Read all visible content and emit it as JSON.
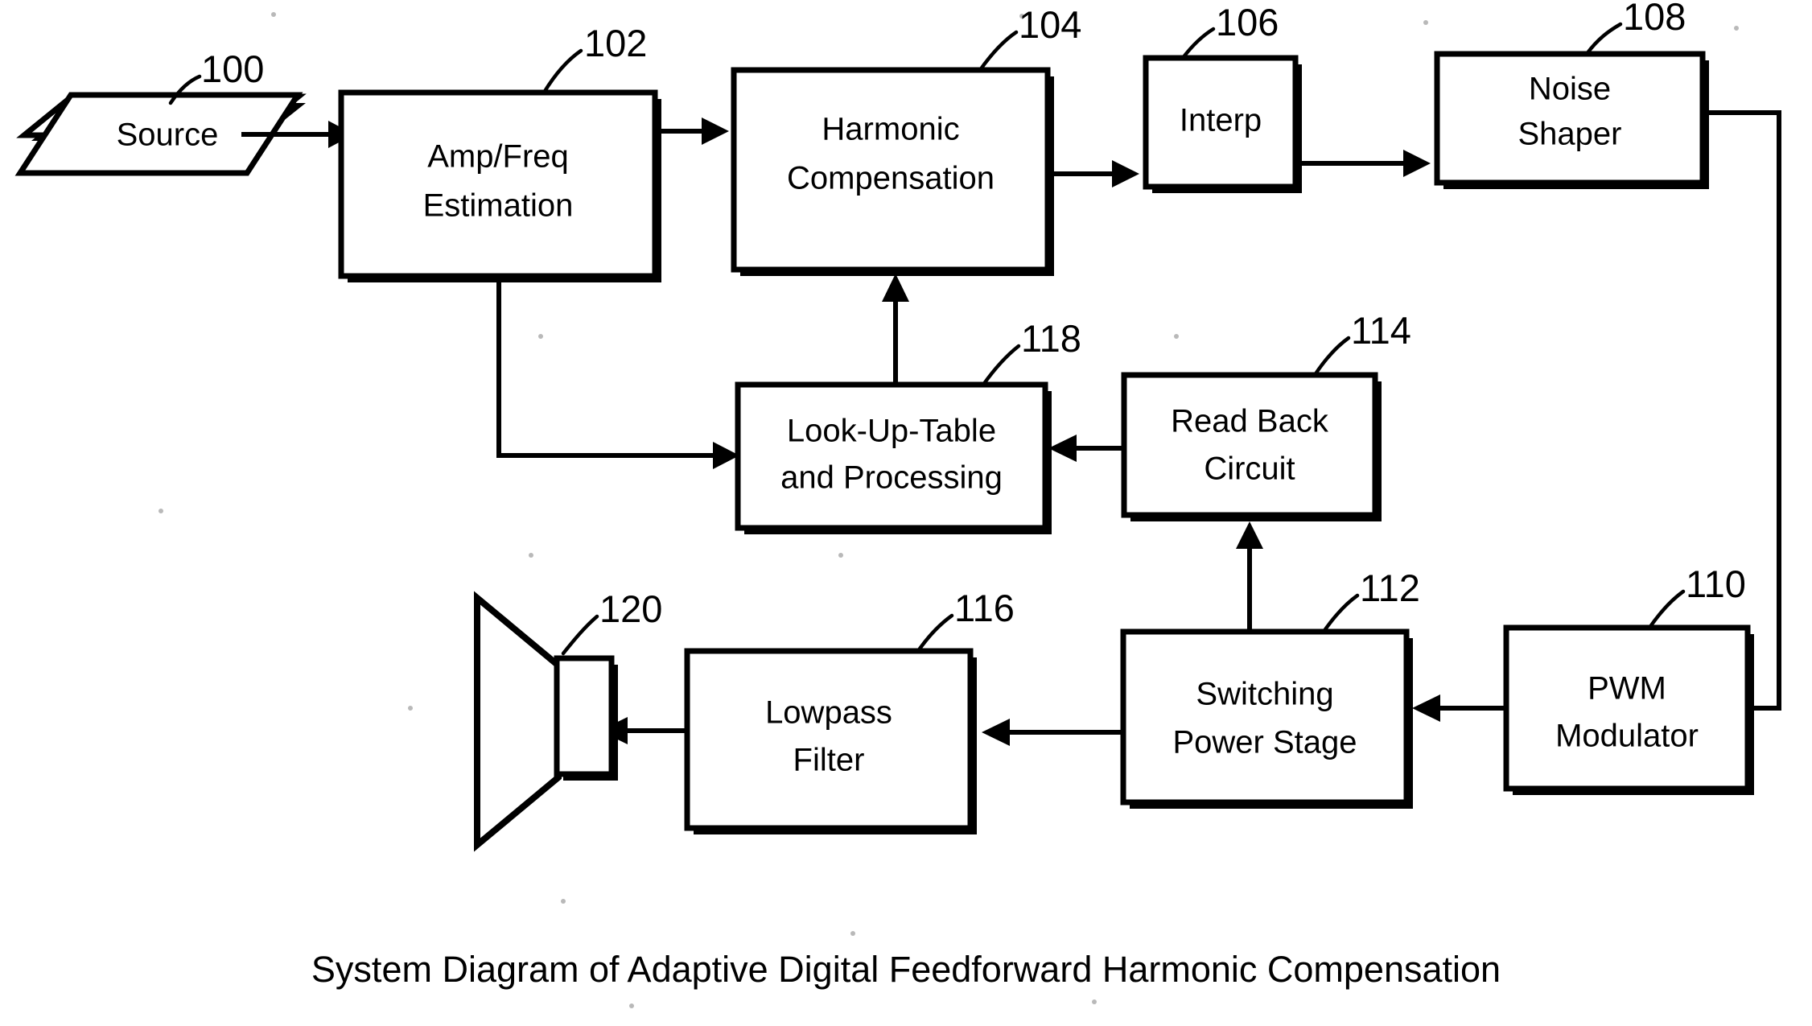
{
  "figure": {
    "caption": "System Diagram of Adaptive Digital Feedforward Harmonic Compensation",
    "line_color": "#000000",
    "background_color": "#ffffff"
  },
  "blocks": {
    "source": {
      "ref": "100",
      "label": "Source",
      "shape": "parallelogram"
    },
    "amp_freq": {
      "ref": "102",
      "label_line1": "Amp/Freq",
      "label_line2": "Estimation",
      "shape": "rectangle"
    },
    "harmonic": {
      "ref": "104",
      "label_line1": "Harmonic",
      "label_line2": "Compensation",
      "shape": "rectangle"
    },
    "interp": {
      "ref": "106",
      "label": "Interp",
      "shape": "rectangle"
    },
    "noise_shaper": {
      "ref": "108",
      "label_line1": "Noise",
      "label_line2": "Shaper",
      "shape": "rectangle"
    },
    "pwm": {
      "ref": "110",
      "label_line1": "PWM",
      "label_line2": "Modulator",
      "shape": "rectangle"
    },
    "switching": {
      "ref": "112",
      "label_line1": "Switching",
      "label_line2": "Power Stage",
      "shape": "rectangle"
    },
    "readback": {
      "ref": "114",
      "label_line1": "Read Back",
      "label_line2": "Circuit",
      "shape": "rectangle"
    },
    "lowpass": {
      "ref": "116",
      "label_line1": "Lowpass",
      "label_line2": "Filter",
      "shape": "rectangle"
    },
    "lut": {
      "ref": "118",
      "label_line1": "Look-Up-Table",
      "label_line2": "and Processing",
      "shape": "rectangle"
    },
    "speaker": {
      "ref": "120",
      "label": "",
      "shape": "loudspeaker"
    }
  },
  "connections": [
    {
      "from": "source",
      "to": "amp_freq",
      "name": "source-to-amp-freq"
    },
    {
      "from": "amp_freq",
      "to": "harmonic",
      "name": "amp-freq-to-harmonic"
    },
    {
      "from": "harmonic",
      "to": "interp",
      "name": "harmonic-to-interp"
    },
    {
      "from": "interp",
      "to": "noise_shaper",
      "name": "interp-to-noise-shaper"
    },
    {
      "from": "noise_shaper",
      "to": "pwm",
      "name": "noise-shaper-to-pwm"
    },
    {
      "from": "pwm",
      "to": "switching",
      "name": "pwm-to-switching"
    },
    {
      "from": "switching",
      "to": "lowpass",
      "name": "switching-to-lowpass"
    },
    {
      "from": "lowpass",
      "to": "speaker",
      "name": "lowpass-to-speaker"
    },
    {
      "from": "switching",
      "to": "readback",
      "name": "switching-to-readback"
    },
    {
      "from": "readback",
      "to": "lut",
      "name": "readback-to-lut"
    },
    {
      "from": "amp_freq",
      "to": "lut",
      "name": "amp-freq-to-lut"
    },
    {
      "from": "lut",
      "to": "harmonic",
      "name": "lut-to-harmonic"
    }
  ]
}
